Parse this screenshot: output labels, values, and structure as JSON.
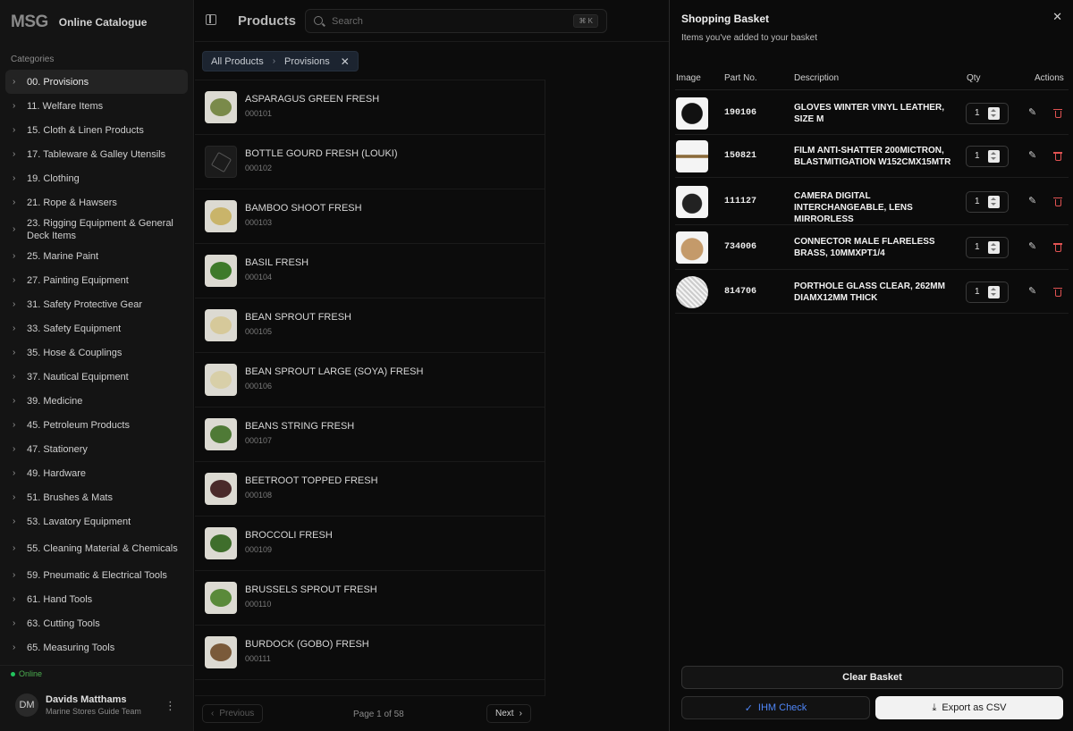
{
  "brand": {
    "logo": "MSG",
    "title": "Online Catalogue"
  },
  "sidebar": {
    "heading": "Categories",
    "items": [
      {
        "label": "00. Provisions"
      },
      {
        "label": "11. Welfare Items"
      },
      {
        "label": "15. Cloth & Linen Products"
      },
      {
        "label": "17. Tableware & Galley Utensils"
      },
      {
        "label": "19. Clothing"
      },
      {
        "label": "21. Rope & Hawsers"
      },
      {
        "label": "23. Rigging Equipment & General Deck Items"
      },
      {
        "label": "25. Marine Paint"
      },
      {
        "label": "27. Painting Equipment"
      },
      {
        "label": "31. Safety Protective Gear"
      },
      {
        "label": "33. Safety Equipment"
      },
      {
        "label": "35. Hose & Couplings"
      },
      {
        "label": "37. Nautical Equipment"
      },
      {
        "label": "39. Medicine"
      },
      {
        "label": "45. Petroleum Products"
      },
      {
        "label": "47. Stationery"
      },
      {
        "label": "49. Hardware"
      },
      {
        "label": "51. Brushes & Mats"
      },
      {
        "label": "53. Lavatory Equipment"
      },
      {
        "label": "55. Cleaning Material & Chemicals"
      },
      {
        "label": "59. Pneumatic & Electrical Tools"
      },
      {
        "label": "61. Hand Tools"
      },
      {
        "label": "63. Cutting Tools"
      },
      {
        "label": "65. Measuring Tools"
      }
    ],
    "status": "Online",
    "user": {
      "initials": "DM",
      "name": "Davids Matthams",
      "team": "Marine Stores Guide Team"
    }
  },
  "header": {
    "title": "Products",
    "search_placeholder": "Search",
    "shortcut": "⌘ K"
  },
  "breadcrumb": {
    "root": "All Products",
    "current": "Provisions"
  },
  "products": [
    {
      "name": "ASPARAGUS GREEN FRESH",
      "code": "000101",
      "thumb": "#7a8a4a",
      "placeholder": false
    },
    {
      "name": "BOTTLE GOURD FRESH (LOUKI)",
      "code": "000102",
      "thumb": "",
      "placeholder": true
    },
    {
      "name": "BAMBOO SHOOT FRESH",
      "code": "000103",
      "thumb": "#c9b46a",
      "placeholder": false
    },
    {
      "name": "BASIL FRESH",
      "code": "000104",
      "thumb": "#3e7a2a",
      "placeholder": false
    },
    {
      "name": "BEAN SPROUT FRESH",
      "code": "000105",
      "thumb": "#d6c99a",
      "placeholder": false
    },
    {
      "name": "BEAN SPROUT LARGE (SOYA) FRESH",
      "code": "000106",
      "thumb": "#d8cfa8",
      "placeholder": false
    },
    {
      "name": "BEANS STRING FRESH",
      "code": "000107",
      "thumb": "#4f7a36",
      "placeholder": false
    },
    {
      "name": "BEETROOT TOPPED FRESH",
      "code": "000108",
      "thumb": "#4a2a2a",
      "placeholder": false
    },
    {
      "name": "BROCCOLI FRESH",
      "code": "000109",
      "thumb": "#3f6e2c",
      "placeholder": false
    },
    {
      "name": "BRUSSELS SPROUT FRESH",
      "code": "000110",
      "thumb": "#5a8a3a",
      "placeholder": false
    },
    {
      "name": "BURDOCK (GOBO) FRESH",
      "code": "000111",
      "thumb": "#7a5a3a",
      "placeholder": false
    }
  ],
  "pagination": {
    "prev": "Previous",
    "info": "Page 1 of 58",
    "next": "Next"
  },
  "basket": {
    "title": "Shopping Basket",
    "subtitle": "Items you've added to your basket",
    "columns": {
      "image": "Image",
      "part": "Part No.",
      "description": "Description",
      "qty": "Qty",
      "actions": "Actions"
    },
    "rows": [
      {
        "part": "190106",
        "description": "GLOVES WINTER VINYL LEATHER, SIZE M",
        "qty": "1",
        "img": "gloves"
      },
      {
        "part": "150821",
        "description": "FILM ANTI-SHATTER 200MICTRON, BLASTMITIGATION W152CMX15MTR",
        "qty": "1",
        "img": "film"
      },
      {
        "part": "111127",
        "description": "CAMERA DIGITAL INTERCHANGEABLE, LENS MIRRORLESS",
        "qty": "1",
        "img": "camera"
      },
      {
        "part": "734006",
        "description": "CONNECTOR MALE FLARELESS BRASS, 10MMXPT1/4",
        "qty": "1",
        "img": "connector"
      },
      {
        "part": "814706",
        "description": "PORTHOLE GLASS CLEAR, 262MM DIAMX12MM THICK",
        "qty": "1",
        "img": "porthole"
      }
    ],
    "clear_label": "Clear Basket",
    "ihm_label": "IHM Check",
    "export_label": "Export as CSV"
  },
  "colors": {
    "accent": "#4f86f7",
    "danger": "#e05252",
    "online": "#22c55e"
  }
}
